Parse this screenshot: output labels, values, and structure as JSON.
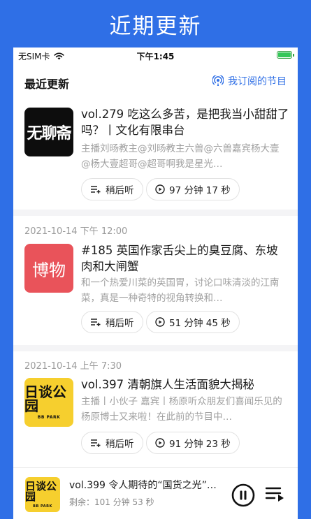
{
  "banner": {
    "title": "近期更新"
  },
  "statusbar": {
    "carrier": "无SIM卡",
    "time": "下午1:45"
  },
  "header": {
    "title": "最近更新",
    "subscribed_label": "我订阅的节目"
  },
  "episodes": [
    {
      "date": "",
      "cover_text": "无聊斋",
      "title": "vol.279 吃这么多苦，是把我当小甜甜了吗？丨文化有限串台",
      "desc": "主播刘旸教主@刘旸教主六兽@六兽嘉宾杨大壹@杨大壹超哥@超哥啊我是星光…",
      "later_label": "稍后听",
      "duration": "97 分钟 17 秒"
    },
    {
      "date": "2021-10-14 下午 12:00",
      "cover_text": "博物",
      "title": "#185 英国作家舌尖上的臭豆腐、东坡肉和大闸蟹",
      "desc": "和一个热爱川菜的英国胃，讨论口味清淡的江南菜，真是一种奇特的视角转换和…",
      "later_label": "稍后听",
      "duration": "51 分钟 45 秒"
    },
    {
      "date": "2021-10-14 上午 7:30",
      "cover_text": "日谈公园",
      "cover_sub": "BB PARK",
      "title": "vol.397 清朝旗人生活面貌大揭秘",
      "desc": "主播丨小伙子 嘉宾丨杨原听众朋友们喜闻乐见的杨原博士又来啦！在此前的节目中…",
      "later_label": "稍后听",
      "duration": "91 分钟 23 秒"
    }
  ],
  "player": {
    "cover_text": "日谈公园",
    "cover_sub": "BB PARK",
    "title": "vol.399 令人期待的“国货之光”…",
    "remaining": "剩余：101 分钟 53 秒"
  },
  "colors": {
    "accent": "#2f6fe6",
    "battery": "#34c759"
  }
}
